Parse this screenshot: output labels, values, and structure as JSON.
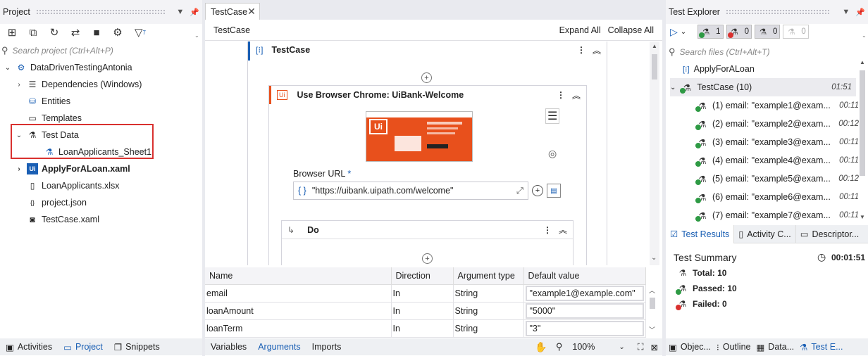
{
  "project": {
    "title": "Project",
    "search_placeholder": "Search project (Ctrl+Alt+P)",
    "filter_count": "7",
    "tree": [
      {
        "label": "DataDrivenTestingAntonia",
        "icon": "project-gear-icon"
      },
      {
        "label": "Dependencies (Windows)",
        "icon": "dependencies-icon"
      },
      {
        "label": "Entities",
        "icon": "database-icon"
      },
      {
        "label": "Templates",
        "icon": "folder-icon"
      },
      {
        "label": "Test Data",
        "icon": "test-data-icon"
      },
      {
        "label": "LoanApplicants_Sheet1",
        "icon": "flask-sheet-icon"
      },
      {
        "label": "ApplyForALoan.xaml",
        "icon": "uipath-icon"
      },
      {
        "label": "LoanApplicants.xlsx",
        "icon": "file-icon"
      },
      {
        "label": "project.json",
        "icon": "json-icon"
      },
      {
        "label": "TestCase.xaml",
        "icon": "xaml-icon"
      }
    ],
    "bottom_tabs": [
      "Activities",
      "Project",
      "Snippets"
    ]
  },
  "designer": {
    "tab_title": "TestCase",
    "breadcrumb": "TestCase",
    "expand_all": "Expand All",
    "collapse_all": "Collapse All",
    "sequence_title": "TestCase",
    "browser_activity_title": "Use Browser Chrome: UiBank-Welcome",
    "browser_url_label": "Browser URL",
    "required_marker": "*",
    "browser_url_value": "\"https://uibank.uipath.com/welcome\"",
    "do_title": "Do",
    "args_table": {
      "headers": [
        "Name",
        "Direction",
        "Argument type",
        "Default value"
      ],
      "rows": [
        [
          "email",
          "In",
          "String",
          "\"example1@example.com\""
        ],
        [
          "loanAmount",
          "In",
          "String",
          "\"5000\""
        ],
        [
          "loanTerm",
          "In",
          "String",
          "\"3\""
        ]
      ]
    },
    "bottom_tabs": [
      "Variables",
      "Arguments",
      "Imports"
    ],
    "zoom": "100%"
  },
  "test_explorer": {
    "title": "Test Explorer",
    "counts": {
      "passed": "1",
      "failed": "0",
      "none": "0",
      "disabled": "0"
    },
    "search_placeholder": "Search files (Ctrl+Alt+T)",
    "apply_item": "ApplyForALoan",
    "testcase_label": "TestCase (10)",
    "testcase_duration": "01:51",
    "items": [
      {
        "label": "(1) email: \"example1@exam...",
        "duration": "00:11"
      },
      {
        "label": "(2) email: \"example2@exam...",
        "duration": "00:12"
      },
      {
        "label": "(3) email: \"example3@exam...",
        "duration": "00:11"
      },
      {
        "label": "(4) email: \"example4@exam...",
        "duration": "00:11"
      },
      {
        "label": "(5) email: \"example5@exam...",
        "duration": "00:12"
      },
      {
        "label": "(6) email: \"example6@exam...",
        "duration": "00:11"
      },
      {
        "label": "(7) email: \"example7@exam...",
        "duration": "00:11"
      }
    ],
    "result_tabs": [
      "Test Results",
      "Activity C...",
      "Descriptor..."
    ],
    "summary_title": "Test Summary",
    "summary_time": "00:01:51",
    "total": "Total: 10",
    "passed": "Passed: 10",
    "failed": "Failed: 0",
    "bottom_tabs": [
      "Objec...",
      "Outline",
      "Data...",
      "Test E..."
    ]
  },
  "colors": {
    "highlight": "#d9312f",
    "accent": "#1a5fb4",
    "uipath_orange": "#e8501c"
  }
}
